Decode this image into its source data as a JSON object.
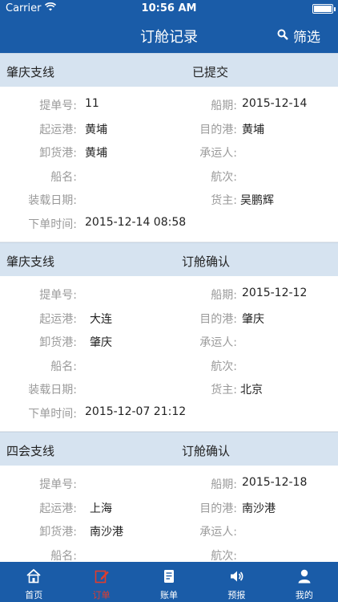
{
  "statusbar": {
    "carrier": "Carrier",
    "time": "10:56 AM"
  },
  "header": {
    "title": "订舱记录",
    "filter_label": "筛选"
  },
  "labels": {
    "bill_no": "提单号:",
    "sail_date": "船期:",
    "load_port": "起运港:",
    "dest_port": "目的港:",
    "discharge_port": "卸货港:",
    "carrier": "承运人:",
    "vessel": "船名:",
    "voyage": "航次:",
    "load_date": "装载日期:",
    "shipper": "货主:",
    "order_time": "下单时间:"
  },
  "orders": [
    {
      "route": "肇庆支线",
      "status": "已提交",
      "bill_no": "11",
      "sail_date": "2015-12-14",
      "load_port": "黄埔",
      "dest_port": "黄埔",
      "discharge_port": "黄埔",
      "carrier": "",
      "vessel": "",
      "voyage": "",
      "load_date": "",
      "shipper": "吴鹏辉",
      "order_time": "2015-12-14 08:58"
    },
    {
      "route": "肇庆支线",
      "status": "订舱确认",
      "bill_no": "",
      "sail_date": "2015-12-12",
      "load_port": "大连",
      "dest_port": "肇庆",
      "discharge_port": "肇庆",
      "carrier": "",
      "vessel": "",
      "voyage": "",
      "load_date": "",
      "shipper": "北京",
      "order_time": "2015-12-07 21:12"
    },
    {
      "route": "四会支线",
      "status": "订舱确认",
      "bill_no": "",
      "sail_date": "2015-12-18",
      "load_port": "上海",
      "dest_port": "南沙港",
      "discharge_port": "南沙港",
      "carrier": "",
      "vessel": "",
      "voyage": ""
    }
  ],
  "tabbar": {
    "active_color": "#e23c2c",
    "items": [
      {
        "label": "首页",
        "icon": "home-icon"
      },
      {
        "label": "订单",
        "icon": "order-edit-icon",
        "active": true
      },
      {
        "label": "账单",
        "icon": "bill-icon"
      },
      {
        "label": "预报",
        "icon": "speaker-icon"
      },
      {
        "label": "我的",
        "icon": "user-icon"
      }
    ]
  },
  "colors": {
    "header_bg": "#1a5ca8",
    "card_head_bg": "#d6e3f0"
  }
}
